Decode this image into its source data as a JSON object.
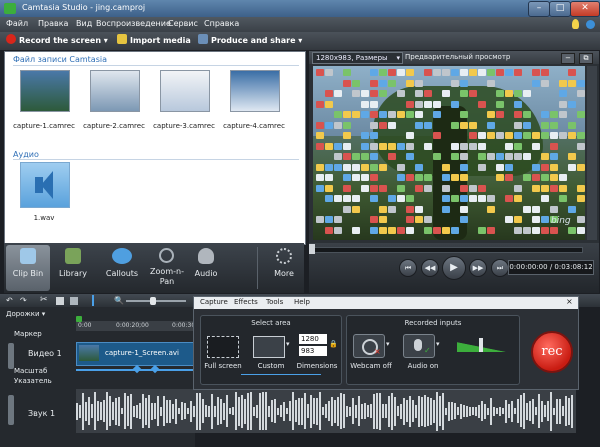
{
  "window": {
    "title": "Camtasia Studio - jing.camproj"
  },
  "menu": [
    "Файл",
    "Правка",
    "Вид",
    "Воспроизведение",
    "Сервис",
    "Справка"
  ],
  "toolbar": {
    "record": "Record the screen ▾",
    "import": "Import media",
    "produce": "Produce and share ▾"
  },
  "bin": {
    "files_title": "Файл записи Camtasia",
    "files": [
      "capture-1.camrec",
      "capture-2.camrec",
      "capture-3.camrec",
      "capture-4.camrec"
    ],
    "audio_title": "Аудио",
    "audio_files": [
      "1.wav"
    ]
  },
  "preview": {
    "size_select": "1280x983, Размеры",
    "size_caret": "▾",
    "label": "Предварительный просмотр",
    "watermark": "bing"
  },
  "tabs": [
    {
      "label": "Clip Bin",
      "icon": "clip-bin-icon",
      "color": "#9fc8e8"
    },
    {
      "label": "Library",
      "icon": "library-icon",
      "color": "#7aa35a"
    },
    {
      "label": "Callouts",
      "icon": "callouts-icon",
      "color": "#4f9fe0"
    },
    {
      "label": "Zoom-n-Pan",
      "icon": "zoom-icon",
      "color": "#9aa3ad"
    },
    {
      "label": "Audio",
      "icon": "audio-icon",
      "color": "#b0b6bd"
    },
    {
      "label": "More",
      "icon": "more-icon",
      "color": "#c8cdd2"
    }
  ],
  "player": {
    "time": "0:00:00:00 / 0:03:08:12"
  },
  "timeline": {
    "tracks_label": "Дорожки",
    "tracks_caret": "▾",
    "marker_label": "Маркер",
    "video_label": "Видео 1",
    "scale_label": "Масштаб",
    "pointer_label": "Указатель",
    "audio_label": "Звук 1",
    "clip_name": "capture-1_Screen.avi",
    "ruler_times": [
      "0:00",
      "0:00:20;00",
      "0:00:30"
    ]
  },
  "recorder": {
    "menu": [
      "Capture",
      "Effects",
      "Tools",
      "Help"
    ],
    "close": "×",
    "select_area": "Select area",
    "full_screen": "Full screen",
    "custom": "Custom",
    "width": "1280",
    "height": "983",
    "dimensions": "Dimensions",
    "recorded_inputs": "Recorded inputs",
    "webcam": "Webcam off",
    "audio": "Audio on",
    "rec_button": "rec",
    "caret": "▾",
    "lock_icon": "🔒",
    "cancel_mark": "×",
    "check_mark": "✓"
  },
  "glyphs": {
    "minimize": "–",
    "maximize": "□",
    "close": "✕",
    "preview_minus": "−",
    "preview_restore": "⧉",
    "play": "▶",
    "prev": "⏮",
    "rewind": "◀◀",
    "forward": "▶▶",
    "next": "⏭"
  },
  "colors": {
    "accent": "#2f6fb6",
    "record_red": "#d8261b",
    "clip_green": "#3cae3c"
  }
}
